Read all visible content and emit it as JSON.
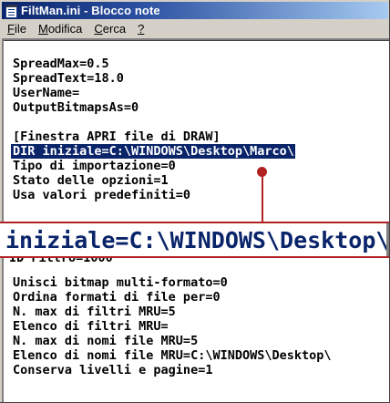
{
  "window": {
    "title": "FiltMan.ini - Blocco note"
  },
  "menu": {
    "items": [
      {
        "accel": "F",
        "rest": "ile"
      },
      {
        "accel": "M",
        "rest": "odifica"
      },
      {
        "accel": "C",
        "rest": "erca"
      },
      {
        "accel": "?",
        "rest": ""
      }
    ]
  },
  "editor": {
    "lines": [
      "SpreadMax=0.5",
      "SpreadText=18.0",
      "UserName=",
      "OutputBitmapsAs=0",
      "",
      "[Finestra APRI file di DRAW]",
      "DIR iniziale=C:\\WINDOWS\\Desktop\\Marco\\",
      "Tipo di importazione=0",
      "Stato delle opzioni=1",
      "Usa valori predefiniti=0"
    ],
    "selected_line_index": 6,
    "partially_hidden_line": "ID Filtro=1000",
    "lines_after": [
      "Unisci bitmap multi-formato=0",
      "Ordina formati di file per=0",
      "N. max di filtri MRU=5",
      "Elenco di filtri MRU=",
      "N. max di nomi file MRU=5",
      "Elenco di nomi file MRU=C:\\WINDOWS\\Desktop\\",
      "Conserva livelli e pagine=1"
    ]
  },
  "magnifier": {
    "text": "iniziale=C:\\WINDOWS\\Desktop\\"
  },
  "colors": {
    "title_start": "#0a246a",
    "title_end": "#a6caf0",
    "selection": "#0a246a",
    "callout": "#b22222"
  }
}
